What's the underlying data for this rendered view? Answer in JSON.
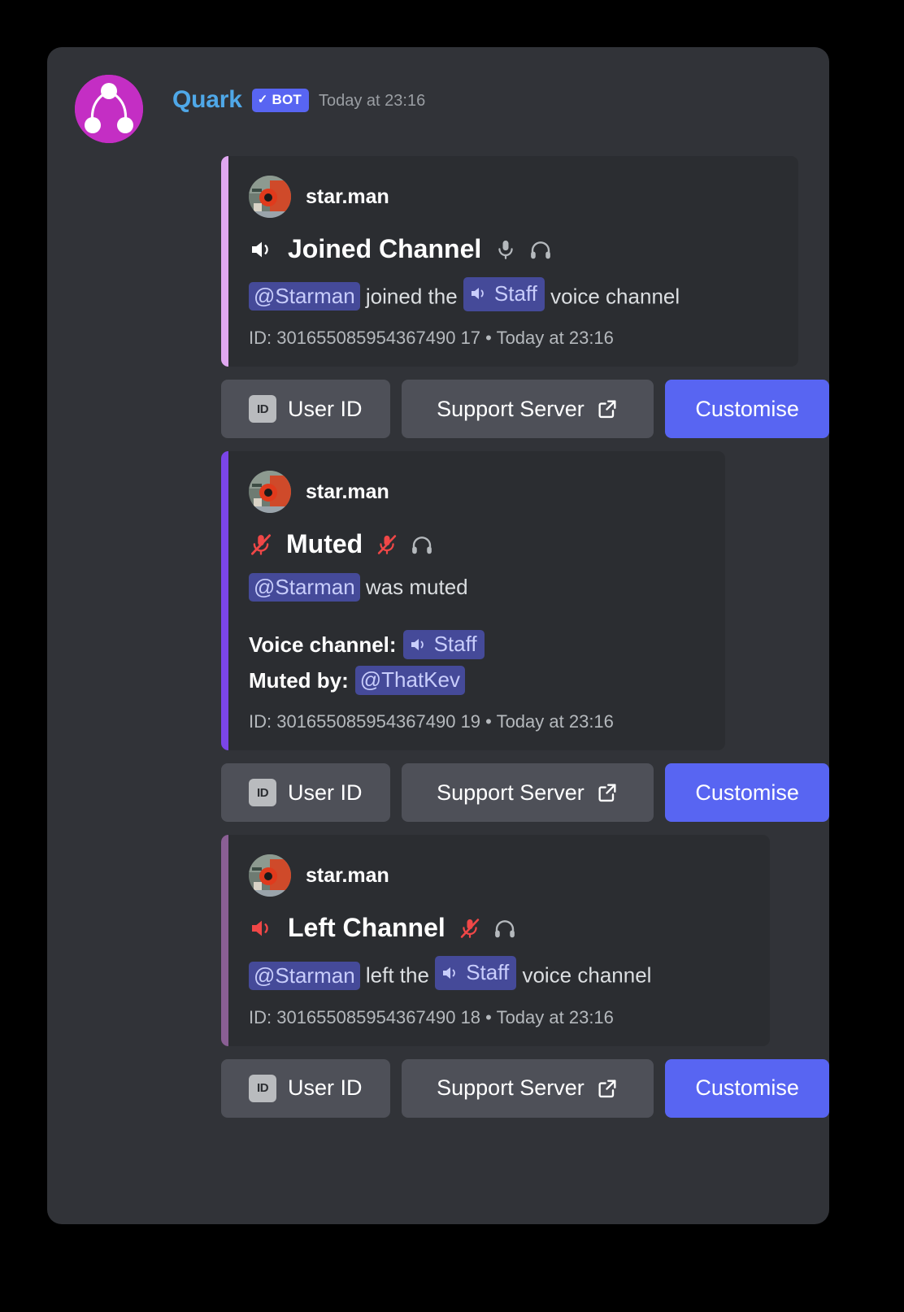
{
  "bot": {
    "name": "Quark",
    "tag_label": "BOT",
    "tag_check": "✓",
    "timestamp": "Today at 23:16",
    "avatar_icon": "quark-particle-logo",
    "avatar_color": "#C42EC4",
    "name_color": "#4FA8E8",
    "tag_color": "#5865F2"
  },
  "buttons": {
    "user_id": "User ID",
    "user_id_icon": "id-badge-icon",
    "support_server": "Support Server",
    "support_server_icon": "external-link-icon",
    "customise": "Customise",
    "primary_color": "#5865F2",
    "secondary_color": "#4E5058"
  },
  "embeds": [
    {
      "accent_color": "#E0A7F0",
      "author": "star.man",
      "author_avatar_icon": "mech-robot-avatar",
      "title": "Joined Channel",
      "title_icons": [
        "speaker-on-icon",
        "microphone-icon",
        "headphones-icon"
      ],
      "title_icon_colors": [
        "#ffffff",
        "#b5b9bd",
        "#b5b9bd"
      ],
      "description": {
        "mention": "@Starman",
        "middle": "joined the",
        "channel": "Staff",
        "channel_icon": "voice-channel-icon",
        "tail": "voice channel"
      },
      "fields": [],
      "footer": "ID: 301655085954367490 17 • Today at 23:16"
    },
    {
      "accent_color": "#7B45E8",
      "author": "star.man",
      "author_avatar_icon": "mech-robot-avatar",
      "title": "Muted",
      "title_icons": [
        "microphone-muted-icon",
        "microphone-muted-icon",
        "headphones-icon"
      ],
      "title_icon_colors": [
        "#F04747",
        "#F04747",
        "#b5b9bd"
      ],
      "description": {
        "mention": "@Starman",
        "middle": "was muted",
        "channel": "",
        "channel_icon": "",
        "tail": ""
      },
      "fields": [
        {
          "name": "Voice channel:",
          "value": "Staff",
          "value_type": "channel",
          "value_icon": "voice-channel-icon"
        },
        {
          "name": "Muted by:",
          "value": "@ThatKev",
          "value_type": "mention",
          "value_icon": ""
        }
      ],
      "footer": "ID: 301655085954367490 19 • Today at 23:16"
    },
    {
      "accent_color": "#8A5F94",
      "author": "star.man",
      "author_avatar_icon": "mech-robot-avatar",
      "title": "Left Channel",
      "title_icons": [
        "speaker-off-icon",
        "microphone-muted-icon",
        "headphones-icon"
      ],
      "title_icon_colors": [
        "#F04747",
        "#F04747",
        "#b5b9bd"
      ],
      "description": {
        "mention": "@Starman",
        "middle": "left the",
        "channel": "Staff",
        "channel_icon": "voice-channel-icon",
        "tail": "voice channel"
      },
      "fields": [],
      "footer": "ID: 301655085954367490 18 • Today at 23:16"
    }
  ]
}
